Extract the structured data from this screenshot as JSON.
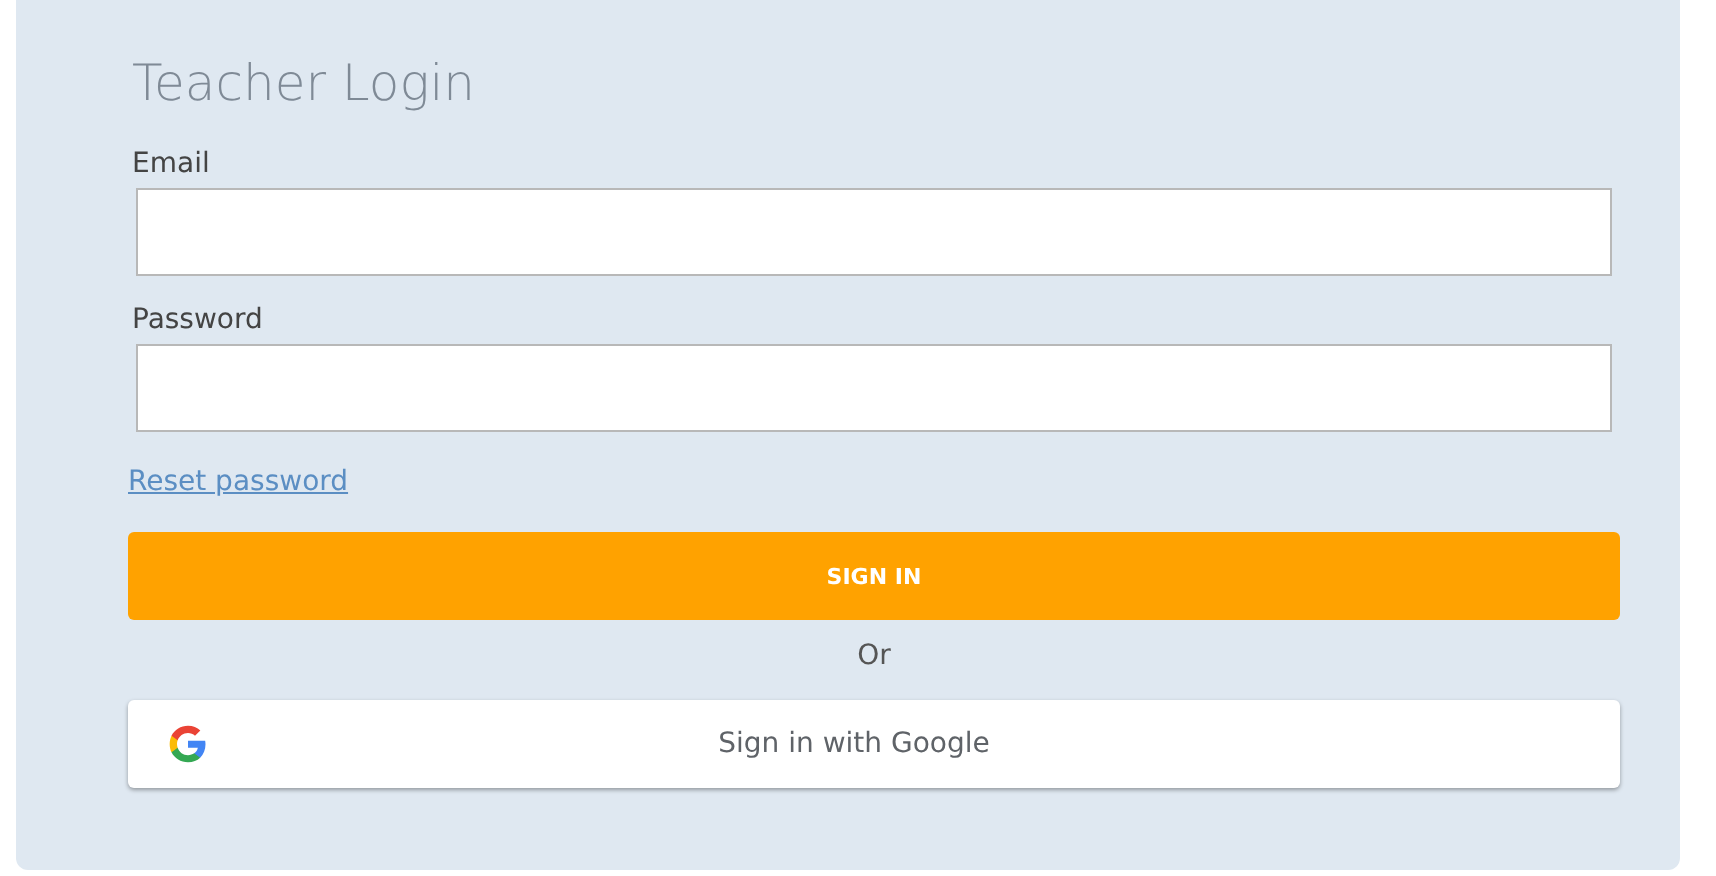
{
  "title": "Teacher Login",
  "fields": [
    {
      "label": "Email"
    },
    {
      "label": "Password"
    }
  ],
  "reset_link": "Reset password",
  "sign_in_button": "SIGN IN",
  "separator": "Or",
  "google_button": "Sign in with Google"
}
